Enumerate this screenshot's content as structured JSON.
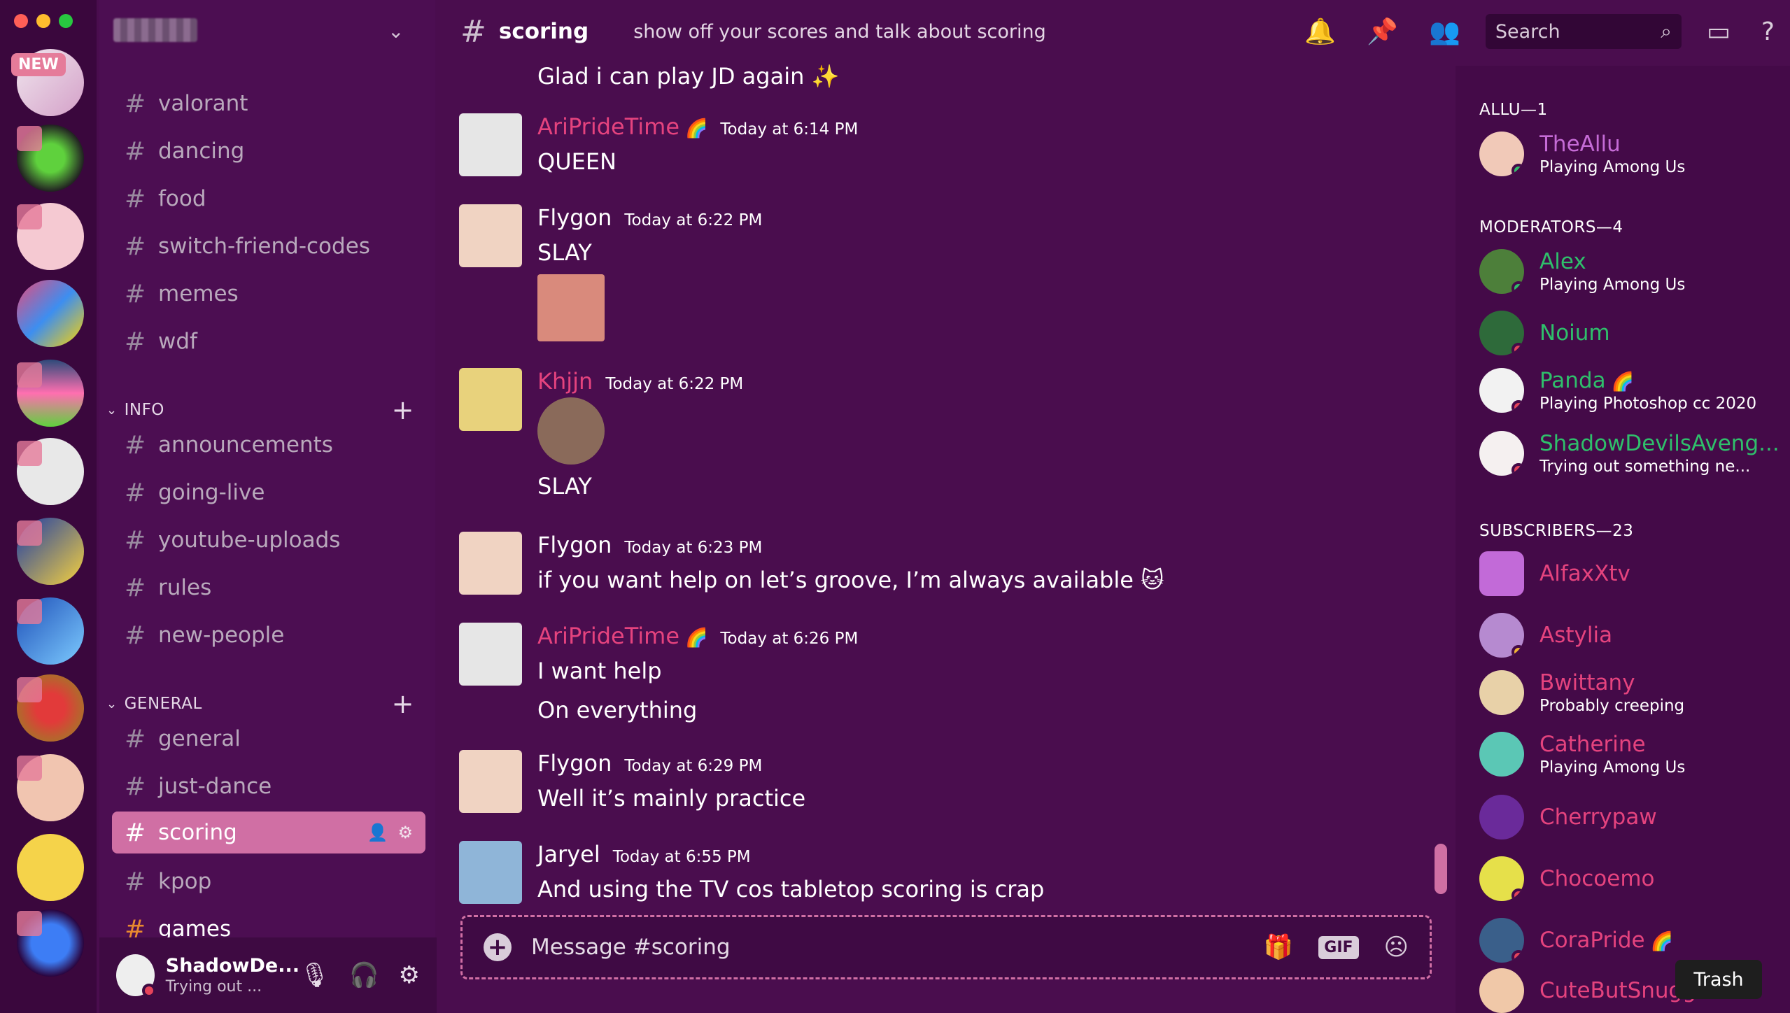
{
  "server_rail": {
    "new_badge": "NEW",
    "icons": [
      "server-avatar-1",
      "server-avatar-2",
      "server-avatar-3",
      "server-avatar-4",
      "server-avatar-5",
      "server-avatar-6",
      "server-avatar-7",
      "server-avatar-8",
      "server-avatar-9",
      "server-avatar-10",
      "server-avatar-11",
      "server-avatar-12",
      "server-avatar-13"
    ]
  },
  "sidebar": {
    "channels_top": [
      "valorant",
      "dancing",
      "food",
      "switch-friend-codes",
      "memes",
      "wdf"
    ],
    "info_label": "INFO",
    "info_channels": [
      "announcements",
      "going-live",
      "youtube-uploads",
      "rules",
      "new-people"
    ],
    "general_label": "GENERAL",
    "general_channels": [
      "general",
      "just-dance",
      "scoring",
      "kpop",
      "games"
    ]
  },
  "user_panel": {
    "name": "ShadowDe...",
    "status": "Trying out ..."
  },
  "top_bar": {
    "channel": "scoring",
    "topic": "show off your scores and talk about scoring",
    "search_placeholder": "Search"
  },
  "messages": [
    {
      "author": "",
      "time": "",
      "text": "Glad i can play JD again ✨"
    },
    {
      "author": "AriPrideTime",
      "time": "Today at 6:14 PM",
      "text": "QUEEN"
    },
    {
      "author": "Flygon",
      "time": "Today at 6:22 PM",
      "text": "SLAY"
    },
    {
      "author": "Khjjn",
      "time": "Today at 6:22 PM",
      "text": "SLAY"
    },
    {
      "author": "Flygon",
      "time": "Today at 6:23 PM",
      "text": "if you want help on let’s groove, I’m always available"
    },
    {
      "author": "AriPrideTime",
      "time": "Today at 6:26 PM",
      "text": "I want help",
      "text2": "On everything"
    },
    {
      "author": "Flygon",
      "time": "Today at 6:29 PM",
      "text": "Well it’s mainly practice"
    },
    {
      "author": "Jaryel",
      "time": "Today at 6:55 PM",
      "text": "And using the TV cos tabletop scoring is crap"
    }
  ],
  "composer": {
    "placeholder": "Message #scoring",
    "gif_label": "GIF"
  },
  "members": {
    "cats": [
      "ALLU—1",
      "MODERATORS—4",
      "SUBSCRIBERS—23"
    ],
    "list": [
      {
        "name": "TheAllu",
        "status": "Playing Among Us"
      },
      {
        "name": "Alex",
        "status": "Playing Among Us"
      },
      {
        "name": "Noium",
        "status": ""
      },
      {
        "name": "Panda",
        "status": "Playing Photoshop cc 2020"
      },
      {
        "name": "ShadowDevilsAveng...",
        "status": "Trying out something ne..."
      },
      {
        "name": "AlfaxXtv",
        "status": ""
      },
      {
        "name": "Astylia",
        "status": ""
      },
      {
        "name": "Bwittany",
        "status": "Probably creeping"
      },
      {
        "name": "Catherine",
        "status": "Playing Among Us"
      },
      {
        "name": "Cherrypaw",
        "status": ""
      },
      {
        "name": "Chocoemo",
        "status": ""
      },
      {
        "name": "CoraPride",
        "status": ""
      },
      {
        "name": "CuteButSnugg...",
        "status": ""
      }
    ]
  },
  "tooltip": "Trash",
  "colors": {
    "accent": "#d06fa4",
    "pink_name": "#e5437e",
    "green_name": "#2fbf6b",
    "purple_name": "#c56bd6"
  }
}
